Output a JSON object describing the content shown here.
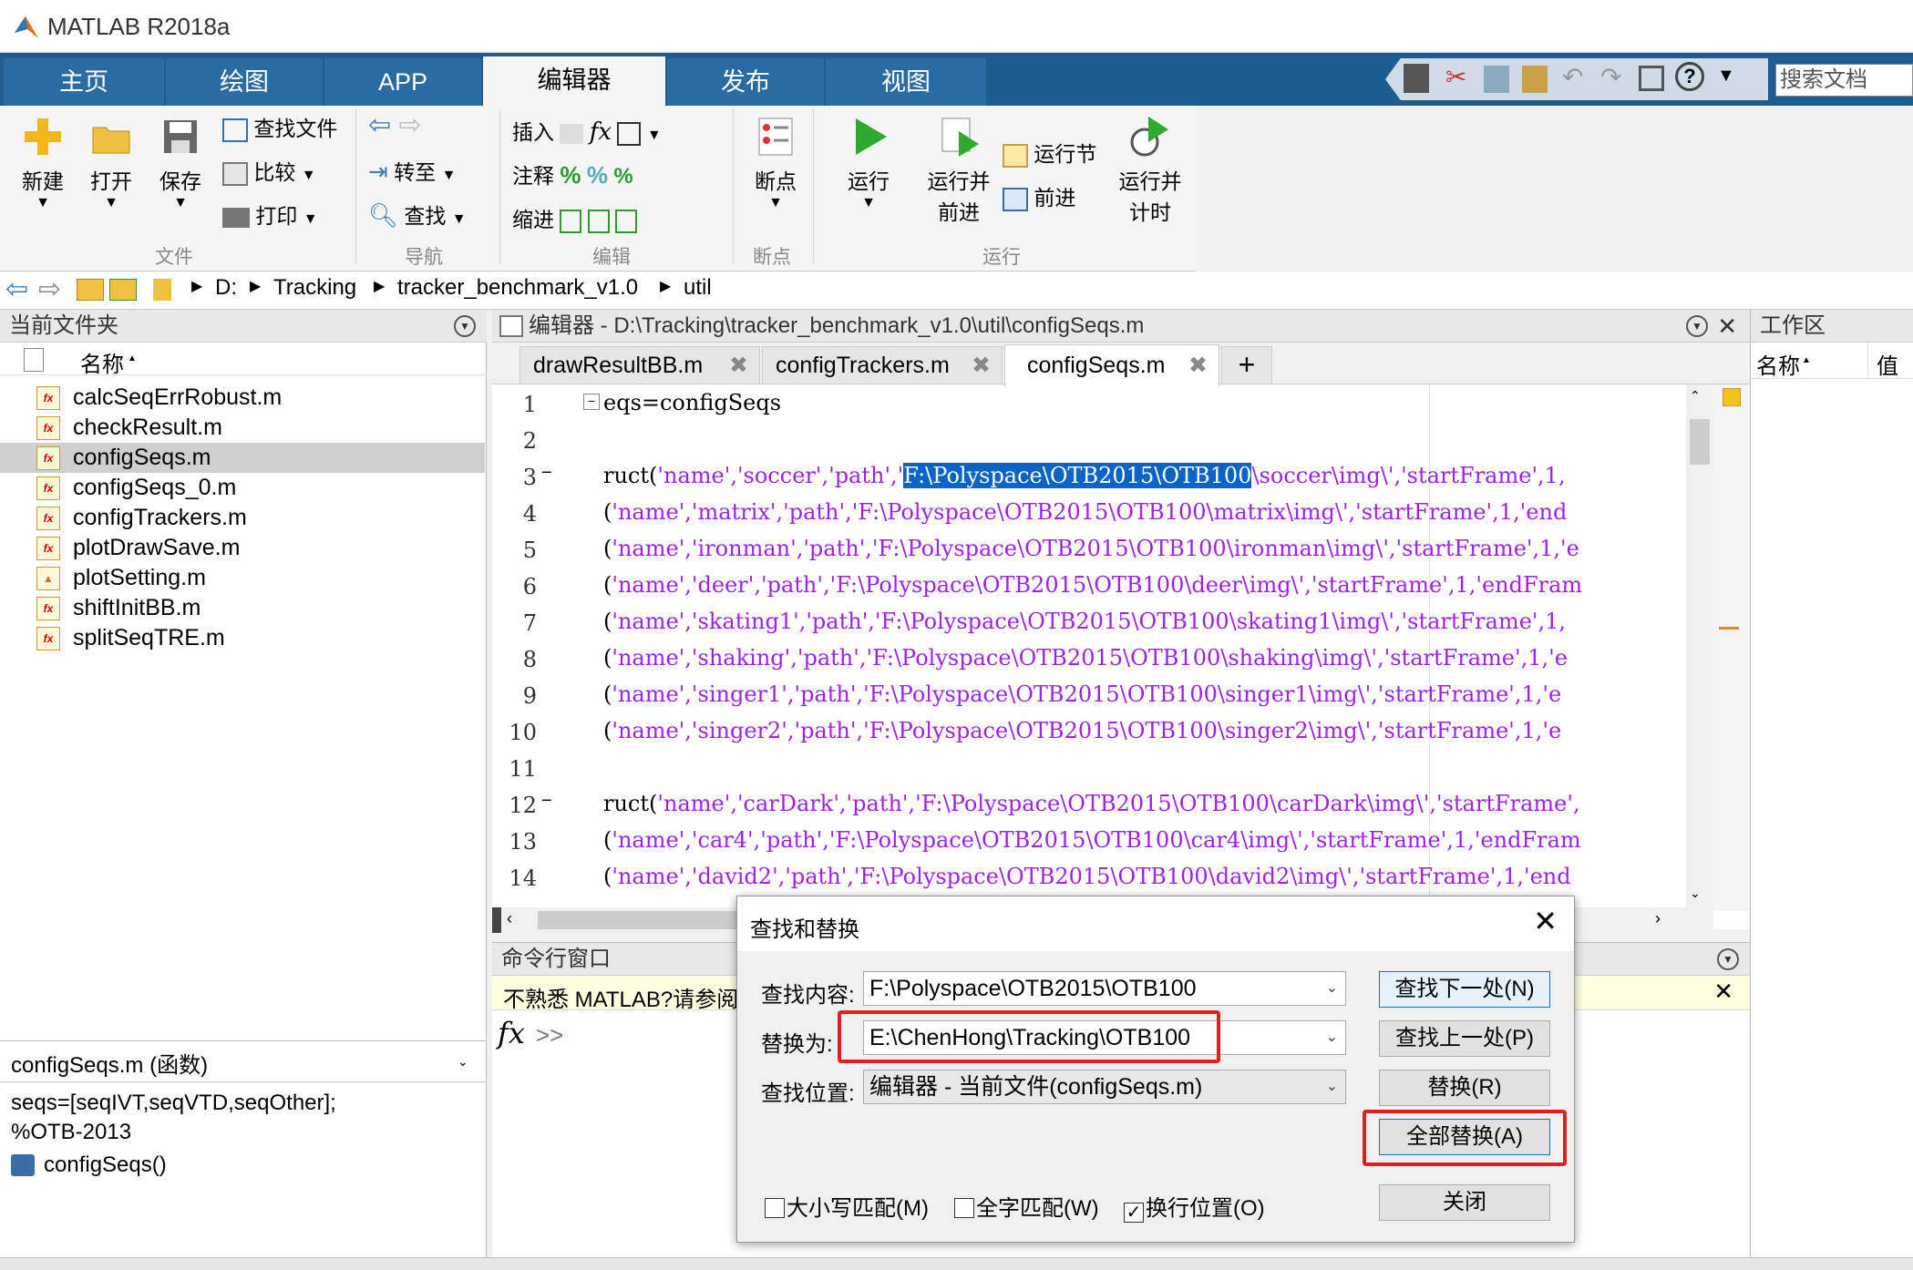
{
  "app": {
    "title": "MATLAB R2018a"
  },
  "tabs": [
    {
      "label": "主页"
    },
    {
      "label": "绘图"
    },
    {
      "label": "APP"
    },
    {
      "label": "编辑器"
    },
    {
      "label": "发布"
    },
    {
      "label": "视图"
    }
  ],
  "search": {
    "placeholder": "搜索文档"
  },
  "ribbon": {
    "new": "新建",
    "open": "打开",
    "save": "保存",
    "find_files": "查找文件",
    "compare": "比较",
    "print": "打印",
    "goto": "转至",
    "find": "查找",
    "insert": "插入",
    "comment": "注释",
    "indent": "缩进",
    "breakpoints": "断点",
    "run": "运行",
    "run_advance_1": "运行并",
    "run_advance_2": "前进",
    "run_section": "运行节",
    "advance": "前进",
    "run_time_1": "运行并",
    "run_time_2": "计时",
    "groups": {
      "file": "文件",
      "nav": "导航",
      "edit": "编辑",
      "bp": "断点",
      "run": "运行"
    }
  },
  "address": {
    "drive": "D:",
    "p1": "Tracking",
    "p2": "tracker_benchmark_v1.0",
    "p3": "util"
  },
  "current_folder": {
    "title": "当前文件夹",
    "col_name": "名称",
    "files": [
      "calcSeqErrRobust.m",
      "checkResult.m",
      "configSeqs.m",
      "configSeqs_0.m",
      "configTrackers.m",
      "plotDrawSave.m",
      "plotSetting.m",
      "shiftInitBB.m",
      "splitSeqTRE.m"
    ],
    "selected": "configSeqs.m"
  },
  "details": {
    "title": "configSeqs.m  (函数)",
    "line1": "seqs=[seqIVT,seqVTD,seqOther];",
    "line2": "%OTB-2013",
    "func": "configSeqs()"
  },
  "editor": {
    "title": "编辑器 - D:\\Tracking\\tracker_benchmark_v1.0\\util\\configSeqs.m",
    "tabs": [
      "drawResultBB.m",
      "configTrackers.m",
      "configSeqs.m"
    ],
    "lines": [
      {
        "n": "1",
        "code": "eqs=configSeqs"
      },
      {
        "n": "2",
        "code": ""
      },
      {
        "n": "3",
        "pre": "ruct(",
        "body": "'name','soccer','path','",
        "sel": "F:\\Polyspace\\OTB2015\\OTB100",
        "post": "\\soccer\\img\\','startFrame',1,"
      },
      {
        "n": "4",
        "pre": "(",
        "body": "'name','matrix','path','F:\\Polyspace\\OTB2015\\OTB100\\matrix\\img\\','startFrame',1,'end"
      },
      {
        "n": "5",
        "pre": "(",
        "body": "'name','ironman','path','F:\\Polyspace\\OTB2015\\OTB100\\ironman\\img\\','startFrame',1,'e"
      },
      {
        "n": "6",
        "pre": "(",
        "body": "'name','deer','path','F:\\Polyspace\\OTB2015\\OTB100\\deer\\img\\','startFrame',1,'endFram"
      },
      {
        "n": "7",
        "pre": "(",
        "body": "'name','skating1','path','F:\\Polyspace\\OTB2015\\OTB100\\skating1\\img\\','startFrame',1,"
      },
      {
        "n": "8",
        "pre": "(",
        "body": "'name','shaking','path','F:\\Polyspace\\OTB2015\\OTB100\\shaking\\img\\','startFrame',1,'e"
      },
      {
        "n": "9",
        "pre": "(",
        "body": "'name','singer1','path','F:\\Polyspace\\OTB2015\\OTB100\\singer1\\img\\','startFrame',1,'e"
      },
      {
        "n": "10",
        "pre": "(",
        "body": "'name','singer2','path','F:\\Polyspace\\OTB2015\\OTB100\\singer2\\img\\','startFrame',1,'e"
      },
      {
        "n": "11",
        "code": ""
      },
      {
        "n": "12",
        "pre": "ruct(",
        "body": "'name','carDark','path','F:\\Polyspace\\OTB2015\\OTB100\\carDark\\img\\','startFrame',"
      },
      {
        "n": "13",
        "pre": "(",
        "body": "'name','car4','path','F:\\Polyspace\\OTB2015\\OTB100\\car4\\img\\','startFrame',1,'endFram"
      },
      {
        "n": "14",
        "pre": "(",
        "body": "'name','david2','path','F:\\Polyspace\\OTB2015\\OTB100\\david2\\img\\','startFrame',1,'end"
      }
    ]
  },
  "command": {
    "title": "命令行窗口",
    "notice": "不熟悉 MATLAB?请参阅",
    "prompt": ">>"
  },
  "workspace": {
    "title": "工作区",
    "col_name": "名称",
    "col_value": "值"
  },
  "dialog": {
    "title": "查找和替换",
    "find_label": "查找内容:",
    "find_value": "F:\\Polyspace\\OTB2015\\OTB100",
    "replace_label": "替换为:",
    "replace_value": "E:\\ChenHong\\Tracking\\OTB100",
    "scope_label": "查找位置:",
    "scope_value": "编辑器 - 当前文件(configSeqs.m)",
    "find_next": "查找下一处(N)",
    "find_prev": "查找上一处(P)",
    "replace": "替换(R)",
    "replace_all": "全部替换(A)",
    "close": "关闭",
    "match_case": "大小写匹配(M)",
    "whole_word": "全字匹配(W)",
    "wrap": "换行位置(O)"
  }
}
